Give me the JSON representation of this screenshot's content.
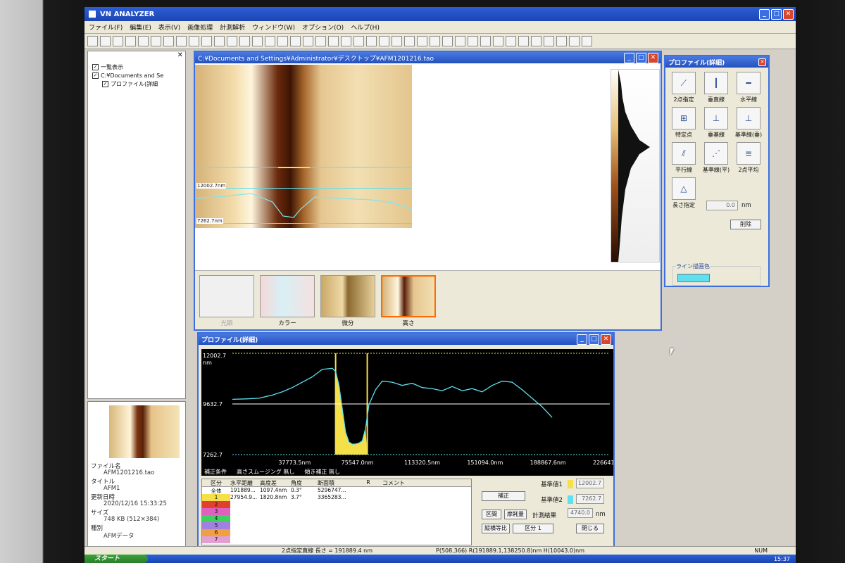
{
  "app": {
    "title": "VN ANALYZER"
  },
  "menu": [
    "ファイル(F)",
    "編集(E)",
    "表示(V)",
    "画像処理",
    "計測解析",
    "ウィンドウ(W)",
    "オプション(O)",
    "ヘルプ(H)"
  ],
  "tree": {
    "items": [
      {
        "label": "一覧表示"
      },
      {
        "label": "C:¥Documents and Se"
      },
      {
        "label": "プロファイル(詳細"
      }
    ]
  },
  "info": {
    "file_label": "ファイル名",
    "file_value": "AFM1201216.tao",
    "title_label": "タイトル",
    "title_value": "AFM1",
    "date_label": "更新日時",
    "date_value": "2020/12/16 15:33:25",
    "size_label": "サイズ",
    "size_value": "748 KB (512×384)",
    "kind_label": "種別",
    "kind_value": "AFMデータ"
  },
  "image_window": {
    "title": "C:¥Documents and Settings¥Administrator¥デスクトップ¥AFM1201216.tao",
    "top_value": "12002.7nm",
    "bottom_value": "7262.7nm",
    "thumbs": [
      {
        "label": "光顕"
      },
      {
        "label": "カラー"
      },
      {
        "label": "微分"
      },
      {
        "label": "高さ"
      }
    ]
  },
  "profile_tools": {
    "title": "プロファイル(詳細)",
    "tools": [
      "2点指定",
      "垂直線",
      "水平線",
      "特定点",
      "垂基線",
      "基準線(垂)",
      "平行線",
      "基準線(平)",
      "2点平均",
      "長さ指定"
    ],
    "length_value": "0.0",
    "length_unit": "nm",
    "delete_label": "削除",
    "line_color_label": "ライン描画色",
    "line_color": "#5ee0f0"
  },
  "chart_window": {
    "title": "プロファイル(詳細)",
    "condition": "補正条件",
    "smoothing": "高さスムージング 無し",
    "slope": "傾き補正 無し",
    "table_headers": [
      "区分",
      "水平距離",
      "高度差",
      "角度",
      "断面積",
      "R",
      "コメント"
    ],
    "rows": [
      {
        "kind": "全体",
        "dist": "191889...",
        "height": "1097.4nm",
        "angle": "0.3°",
        "area": "5296747..."
      },
      {
        "kind": "1",
        "dist": "27954.9...",
        "height": "1820.8nm",
        "angle": "3.7°",
        "area": "3365283..."
      },
      {
        "kind": "2",
        "dist": "",
        "height": "",
        "angle": "",
        "area": ""
      },
      {
        "kind": "3",
        "dist": "",
        "height": "",
        "angle": "",
        "area": ""
      },
      {
        "kind": "4",
        "dist": "",
        "height": "",
        "angle": "",
        "area": ""
      },
      {
        "kind": "5",
        "dist": "",
        "height": "",
        "angle": "",
        "area": ""
      },
      {
        "kind": "6",
        "dist": "",
        "height": "",
        "angle": "",
        "area": ""
      },
      {
        "kind": "7",
        "dist": "",
        "height": "",
        "angle": "",
        "area": ""
      }
    ],
    "row_colors": [
      "#ffffff",
      "#f5e04a",
      "#e04030",
      "#e060c0",
      "#40d060",
      "#a080e0",
      "#f0a040",
      "#e0a0d0"
    ],
    "correction_label": "補正",
    "ref1_label": "基準値1",
    "ref1_value": "12002.7",
    "ref2_label": "基準値2",
    "ref2_value": "7262.7",
    "ref_unit": "nm",
    "interval_label": "区間",
    "friction_label": "摩耗量",
    "measure_label": "計測結果",
    "measure_value": "4740.0",
    "measure_unit": "nm",
    "aspect_label": "縦横等比",
    "div_label": "区分 1",
    "close_label": "閉じる"
  },
  "chart_data": {
    "type": "line",
    "xlabel": "",
    "ylabel": "nm",
    "ylim": [
      7262.7,
      12002.7
    ],
    "y_ticks": [
      "12002.7",
      "9632.7",
      "7262.7"
    ],
    "x_ticks": [
      "37773.5nm",
      "75547.0nm",
      "113320.5nm",
      "151094.0nm",
      "188867.6nm",
      "226641.1nm"
    ],
    "xlim": [
      0,
      226641.1
    ],
    "reference_line": 9632.7,
    "highlight_region": [
      62000,
      81000
    ],
    "series": [
      {
        "x": [
          0,
          8000,
          16000,
          24000,
          30000,
          36000,
          42000,
          48000,
          54000,
          60000,
          62000,
          64000,
          66000,
          68000,
          70000,
          72000,
          74000,
          76000,
          78000,
          80000,
          82000,
          86000,
          90000,
          96000,
          102000,
          108000,
          114000,
          120000,
          126000,
          132000,
          138000,
          144000,
          150000,
          156000,
          162000,
          168000,
          174000,
          180000,
          186000,
          192000
        ],
        "values": [
          9850,
          9870,
          9900,
          10050,
          10200,
          10400,
          10650,
          10900,
          11250,
          11300,
          11150,
          10500,
          9400,
          8300,
          7850,
          7750,
          7760,
          7800,
          7900,
          8500,
          9600,
          10300,
          10700,
          10650,
          10500,
          10600,
          10400,
          10350,
          10250,
          10450,
          10250,
          10350,
          10200,
          10500,
          10700,
          10650,
          10300,
          9900,
          9500,
          9000
        ]
      }
    ]
  },
  "status": {
    "mode": "2点指定直線  長さ = 191889.4 nm",
    "coords": "P(508,366)  R(191889.1,138250.8)nm  H(10043.0)nm",
    "num": "NUM"
  },
  "taskbar": {
    "start": "スタート",
    "clock": "15:37"
  }
}
